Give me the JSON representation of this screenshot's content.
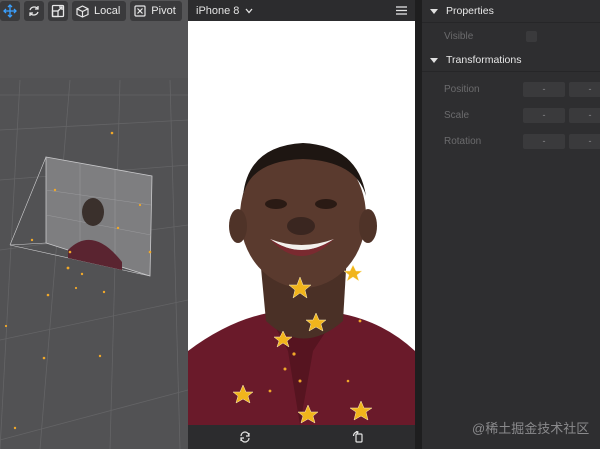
{
  "toolbar": {
    "tools": [
      {
        "icon": "move-arrows-icon",
        "active": true
      },
      {
        "icon": "rotate-icon",
        "active": false
      },
      {
        "icon": "scale-box-icon",
        "active": false
      }
    ],
    "local_label": "Local",
    "pivot_label": "Pivot"
  },
  "device": {
    "name": "iPhone 8",
    "menu_icon": "hamburger-menu-icon",
    "footer_icons": [
      "restart-icon",
      "rotate-device-icon"
    ]
  },
  "inspector": {
    "properties": {
      "title": "Properties",
      "visible_label": "Visible"
    },
    "transformations": {
      "title": "Transformations",
      "rows": [
        {
          "label": "Position",
          "values": [
            "-",
            "-"
          ]
        },
        {
          "label": "Scale",
          "values": [
            "-",
            "-"
          ]
        },
        {
          "label": "Rotation",
          "values": [
            "-",
            "-"
          ]
        }
      ]
    }
  },
  "watermark": "@稀土掘金技术社区",
  "colors": {
    "accent": "#3aa0ff",
    "star": "#f1b51c",
    "shirt": "#6a1a2a"
  }
}
